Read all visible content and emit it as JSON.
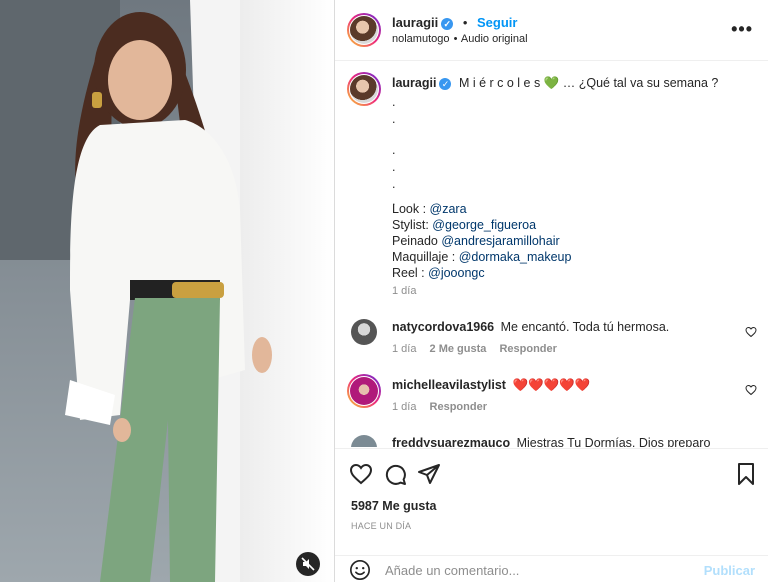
{
  "post": {
    "author": "lauragii",
    "follow_label": "Seguir",
    "dot": "•",
    "audio_user": "nolamutogo",
    "audio_label": "Audio original",
    "more": "•••"
  },
  "caption": {
    "author": "lauragii",
    "text": "M i é r c o l e s 💚 … ¿Qué tal va su semana ?",
    "dots": [
      ".",
      ".",
      ".",
      ".",
      ".",
      "."
    ],
    "credits": [
      {
        "label": "Look : ",
        "handle": "@zara"
      },
      {
        "label": "Stylist: ",
        "handle": "@george_figueroa"
      },
      {
        "label": "Peinado ",
        "handle": "@andresjaramillohair"
      },
      {
        "label": "Maquillaje : ",
        "handle": "@dormaka_makeup"
      },
      {
        "label": "Reel : ",
        "handle": "@jooongc"
      }
    ],
    "time": "1 día"
  },
  "comments": [
    {
      "user": "natycordova1966",
      "text": "Me encantó. Toda tú hermosa.",
      "time": "1 día",
      "likes": "2 Me gusta",
      "reply": "Responder"
    },
    {
      "user": "michelleavilastylist",
      "text": "❤️❤️❤️❤️❤️",
      "time": "1 día",
      "reply": "Responder"
    },
    {
      "user": "freddysuarezmauco",
      "text": "Miestras Tu Dormías, Dios preparo"
    }
  ],
  "stats": {
    "likes": "5987 Me gusta",
    "ago": "HACE UN DÍA"
  },
  "add_comment": {
    "placeholder": "Añade un comentario...",
    "publish": "Publicar"
  },
  "colors": {
    "link": "#00376b",
    "accent": "#0095f6",
    "muted": "#8e8e8e"
  }
}
